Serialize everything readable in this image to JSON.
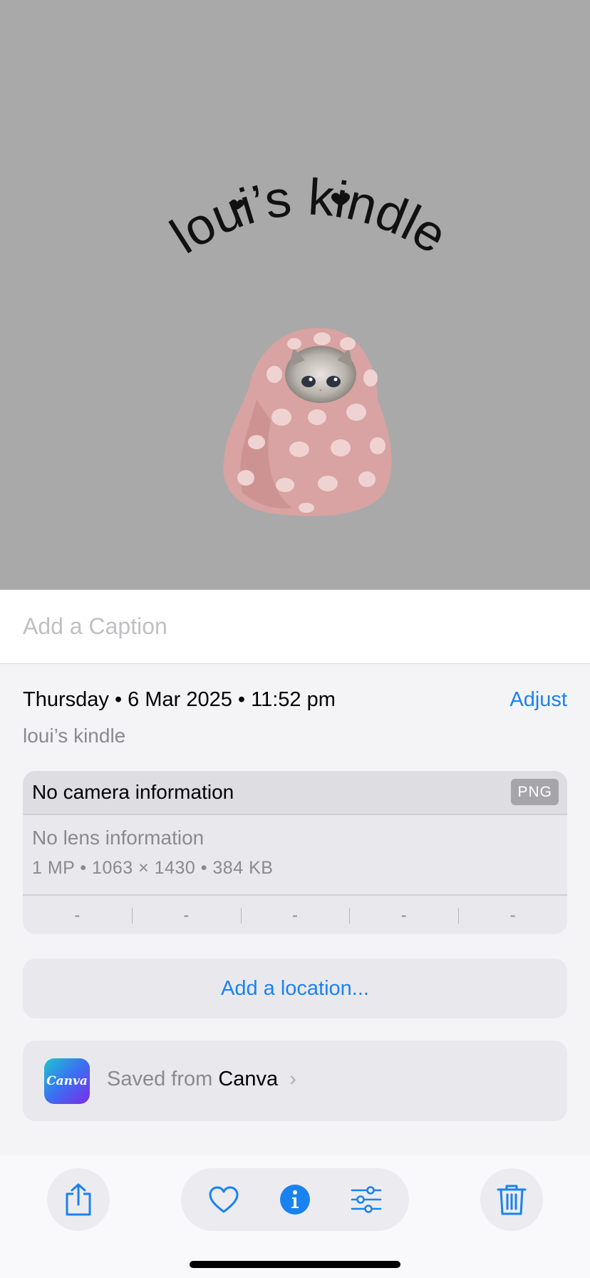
{
  "photo": {
    "image_text": "loui’s kindle",
    "background_color": "#a9a9a9",
    "subject": "kitten wrapped in pink polka-dot blanket"
  },
  "caption": {
    "placeholder": "Add a Caption",
    "value": ""
  },
  "details": {
    "date_line": "Thursday • 6 Mar 2025 • 11:52 pm",
    "adjust_label": "Adjust",
    "subtitle": "loui’s kindle"
  },
  "metadata": {
    "camera": "No camera information",
    "format_badge": "PNG",
    "lens": "No lens information",
    "specs": "1 MP • 1063 × 1430 • 384 KB",
    "exif": [
      "-",
      "-",
      "-",
      "-",
      "-"
    ]
  },
  "location": {
    "label": "Add a location..."
  },
  "source": {
    "icon_text": "Canva",
    "prefix": "Saved from",
    "app": "Canva",
    "chevron": "›"
  },
  "toolbar": {
    "icons": [
      "share-icon",
      "heart-icon",
      "info-icon",
      "adjustments-icon",
      "trash-icon"
    ],
    "accent": "#1a82f0"
  }
}
